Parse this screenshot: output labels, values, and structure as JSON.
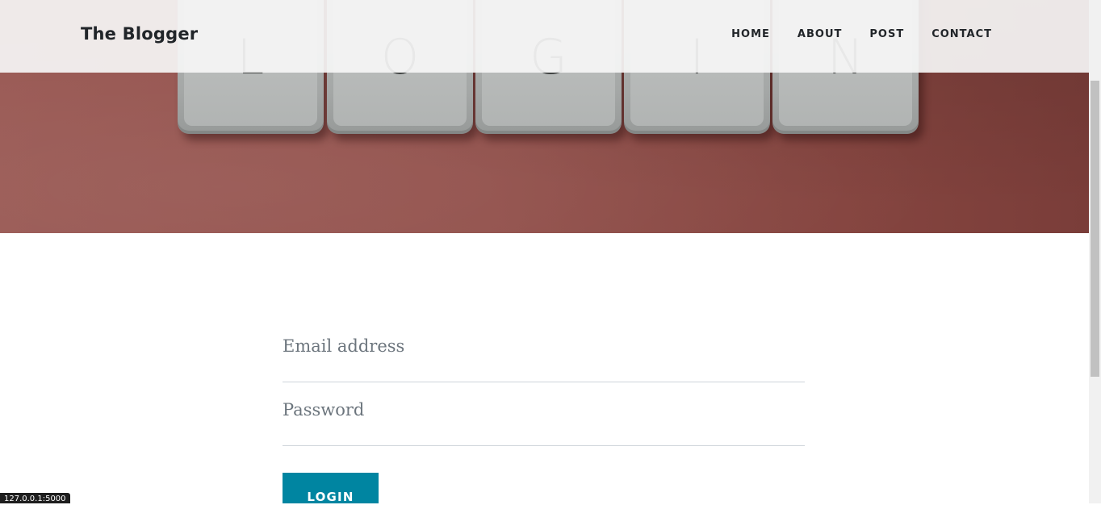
{
  "navbar": {
    "brand": "The Blogger",
    "links": [
      {
        "label": "HOME"
      },
      {
        "label": "ABOUT"
      },
      {
        "label": "POST"
      },
      {
        "label": "CONTACT"
      }
    ]
  },
  "hero": {
    "keycaps": [
      "L",
      "O",
      "G",
      "I",
      "N"
    ],
    "background_color": "#93524d"
  },
  "login_form": {
    "email_placeholder": "Email address",
    "password_placeholder": "Password",
    "submit_label": "LOGIN",
    "button_color": "#0085a1"
  },
  "status_bar": {
    "url": "127.0.0.1:5000"
  }
}
